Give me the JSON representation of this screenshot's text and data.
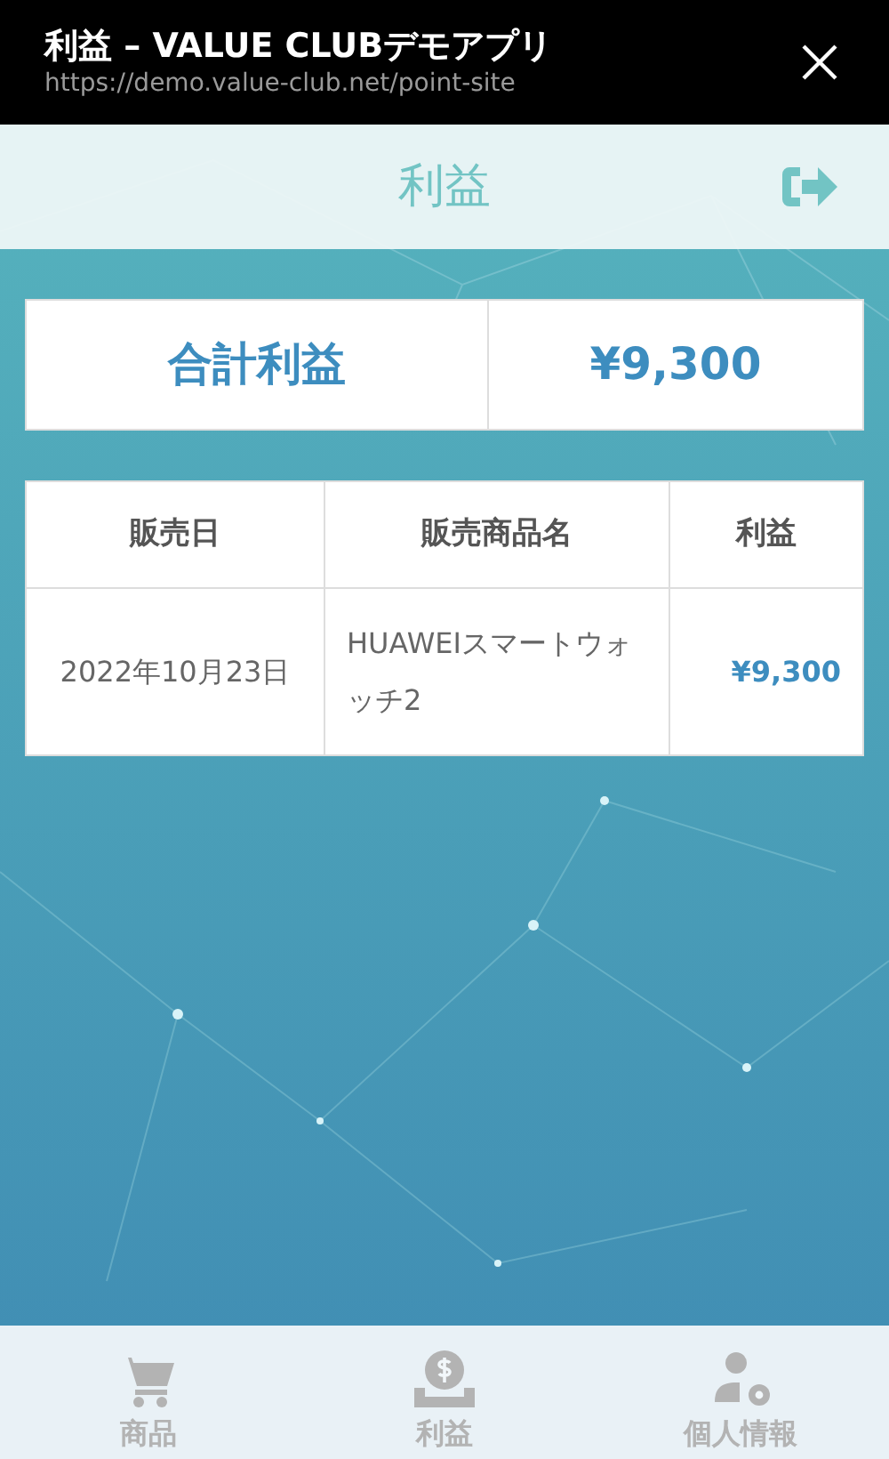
{
  "browser_bar": {
    "title": "利益 – VALUE CLUBデモアプリ",
    "url": "https://demo.value-club.net/point-site"
  },
  "header": {
    "title": "利益"
  },
  "summary": {
    "label": "合計利益",
    "value": "¥9,300"
  },
  "table": {
    "columns": [
      "販売日",
      "販売商品名",
      "利益"
    ],
    "rows": [
      [
        "2022年10月23日",
        "HUAWEIスマートウォッチ2",
        "¥9,300"
      ]
    ]
  },
  "bottom_nav": [
    {
      "label": "商品",
      "kind": "cart"
    },
    {
      "label": "利益",
      "kind": "money"
    },
    {
      "label": "個人情報",
      "kind": "user"
    }
  ]
}
